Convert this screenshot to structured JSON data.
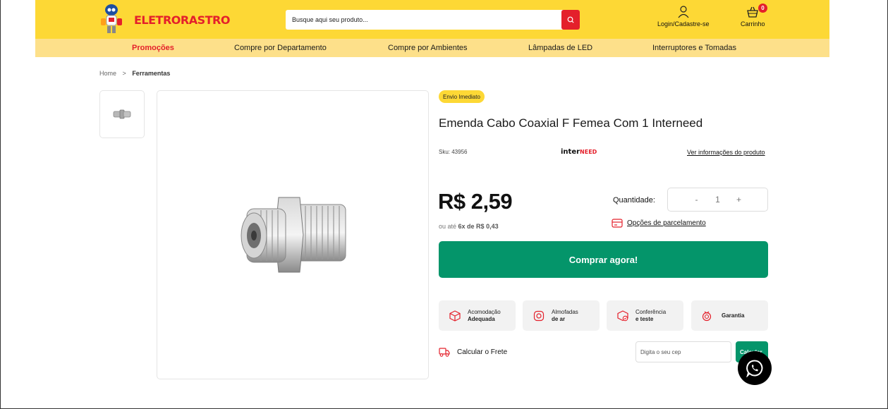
{
  "header": {
    "logo_text": "ELETRORASTRO",
    "search_placeholder": "Busque aqui seu produto...",
    "login_label": "Login/Cadastre-se",
    "cart_label": "Carrinho",
    "cart_count": "0"
  },
  "nav": {
    "items": [
      "Promoções",
      "Compre por Departamento",
      "Compre por Ambientes",
      "Lâmpadas de LED",
      "Interruptores e Tomadas"
    ]
  },
  "breadcrumb": {
    "home": "Home",
    "separator": ">",
    "current": "Ferramentas"
  },
  "product": {
    "badge": "Envio Imediato",
    "title": "Emenda Cabo Coaxial F Femea Com 1 Interneed",
    "sku": "Sku: 43956",
    "brand_part1": "inter",
    "brand_part2": "NEED",
    "info_link": "Ver informações do produto",
    "price": "R$ 2,59",
    "installment_prefix": "ou até",
    "installment_value": "6x de R$ 0,43",
    "quantity_label": "Quantidade:",
    "quantity_minus": "-",
    "quantity_value": "1",
    "quantity_plus": "+",
    "parcel_link": "Opções de parcelamento",
    "buy_label": "Comprar agora!"
  },
  "features": [
    {
      "line1": "Acomodação",
      "line2": "Adequada",
      "icon": "box-icon"
    },
    {
      "line1": "Almofadas",
      "line2": "de ar",
      "icon": "air-cushion-icon"
    },
    {
      "line1": "Conferência",
      "line2": "e teste",
      "icon": "check-box-icon"
    },
    {
      "line1": "",
      "line2": "Garantia",
      "icon": "warranty-icon"
    }
  ],
  "shipping": {
    "label": "Calcular o Frete",
    "cep_placeholder": "Digita o seu cep",
    "calc_label": "Calcular"
  },
  "colors": {
    "accent_yellow": "#fdd835",
    "nav_yellow": "#fde08a",
    "brand_red": "#e4202b",
    "buy_green": "#04956a"
  }
}
